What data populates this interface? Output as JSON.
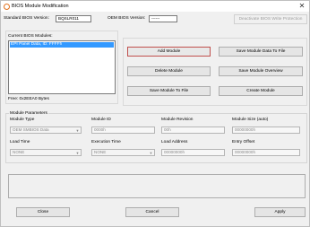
{
  "window": {
    "title": "BIOS Module Modification",
    "close_glyph": "✕"
  },
  "header": {
    "standard_bios_version_label": "Standard BIOS Version:",
    "standard_bios_version_value": "BQSLR011",
    "oem_bios_version_label": "OEM BIOS Version:",
    "oem_bios_version_value": "------",
    "deactivate_button": "Deactivate BIOS Write Protection"
  },
  "modules": {
    "label": "Current BIOS Modules:",
    "items": [
      "EPI Panel Data, ID: FFFFh"
    ],
    "free_label": "Free: 0x2EEA0 Bytes"
  },
  "actions": {
    "add_module": "Add Module",
    "save_module_data_to_file": "Save Module Data To File",
    "delete_module": "Delete Module",
    "save_module_overview": "Save Module Overview",
    "save_module_to_file": "Save Module To File",
    "create_module": "Create Module"
  },
  "params": {
    "legend": "Module Parameters",
    "module_type_label": "Module Type",
    "module_type_value": "OEM SMBIOS Data",
    "module_id_label": "Module ID",
    "module_id_value": "0000h",
    "module_revision_label": "Module Revision",
    "module_revision_value": "00h",
    "module_size_label": "Module Size (auto)",
    "module_size_value": "00000000h",
    "load_time_label": "Load Time",
    "load_time_value": "NONE",
    "execution_time_label": "Execution Time",
    "execution_time_value": "NONE",
    "load_address_label": "Load Address",
    "load_address_value": "00000000h",
    "entry_offset_label": "Entry Offset",
    "entry_offset_value": "00000000h"
  },
  "footer": {
    "close": "Close",
    "cancel": "Cancel",
    "apply": "Apply"
  },
  "colors": {
    "selection": "#3399ff",
    "focus_border": "#c0504d",
    "window_bg": "#f0f0f0",
    "app_icon": "#e0701c"
  },
  "icons": {
    "app": "app-icon",
    "close": "close-icon",
    "dropdown": "chevron-down-icon"
  }
}
